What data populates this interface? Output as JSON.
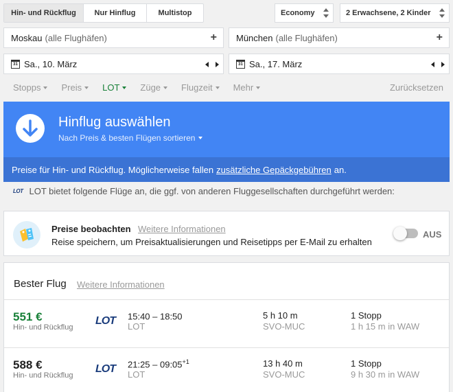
{
  "trip_types": [
    {
      "label": "Hin- und Rückflug",
      "active": true
    },
    {
      "label": "Nur Hinflug",
      "active": false
    },
    {
      "label": "Multistop",
      "active": false
    }
  ],
  "cabin_class": "Economy",
  "passengers": "2 Erwachsene, 2 Kinder",
  "origin": {
    "city": "Moskau",
    "detail": "(alle Flughäfen)"
  },
  "destination": {
    "city": "München",
    "detail": "(alle Flughäfen)"
  },
  "depart_date": "Sa., 10. März",
  "return_date": "Sa., 17. März",
  "calendar_icon_text": "31",
  "filters": [
    {
      "label": "Stopps",
      "active": false
    },
    {
      "label": "Preis",
      "active": false
    },
    {
      "label": "LOT",
      "active": true
    },
    {
      "label": "Züge",
      "active": false
    },
    {
      "label": "Flugzeit",
      "active": false
    },
    {
      "label": "Mehr",
      "active": false
    }
  ],
  "reset_label": "Zurücksetzen",
  "banner": {
    "title": "Hinflug auswählen",
    "subtitle": "Nach Preis & besten Flügen sortieren",
    "notice_before": "Preise für Hin- und Rückflug. Möglicherweise fallen",
    "notice_link": "zusätzliche Gepäckgebühren",
    "notice_after": "an."
  },
  "airline_notice": "LOT bietet folgende Flüge an, die ggf. von anderen Fluggesellschaften durchgeführt werden:",
  "price_watch": {
    "title": "Preise beobachten",
    "link": "Weitere Informationen",
    "description": "Reise speichern, um Preisaktualisierungen und Reisetipps per E-Mail zu erhalten",
    "toggle_label": "AUS"
  },
  "best_flights": {
    "title": "Bester Flug",
    "link": "Weitere Informationen"
  },
  "flights": [
    {
      "price": "551 €",
      "price_type": "Hin- und Rückflug",
      "logo": "LOT",
      "time": "15:40 – 18:50",
      "day_offset": "",
      "airline": "LOT",
      "duration": "5 h 10 m",
      "route": "SVO-MUC",
      "stops": "1 Stopp",
      "layover": "1 h 15 m in WAW",
      "highlight": true
    },
    {
      "price": "588 €",
      "price_type": "Hin- und Rückflug",
      "logo": "LOT",
      "time": "21:25 – 09:05",
      "day_offset": "+1",
      "airline": "LOT",
      "duration": "13 h 40 m",
      "route": "SVO-MUC",
      "stops": "1 Stopp",
      "layover": "9 h 30 m in WAW",
      "highlight": false
    }
  ],
  "colors": {
    "banner_blue": "#4285f4",
    "banner_strip": "#3b73d4",
    "green": "#188038",
    "lot_blue": "#1a3c7c"
  }
}
